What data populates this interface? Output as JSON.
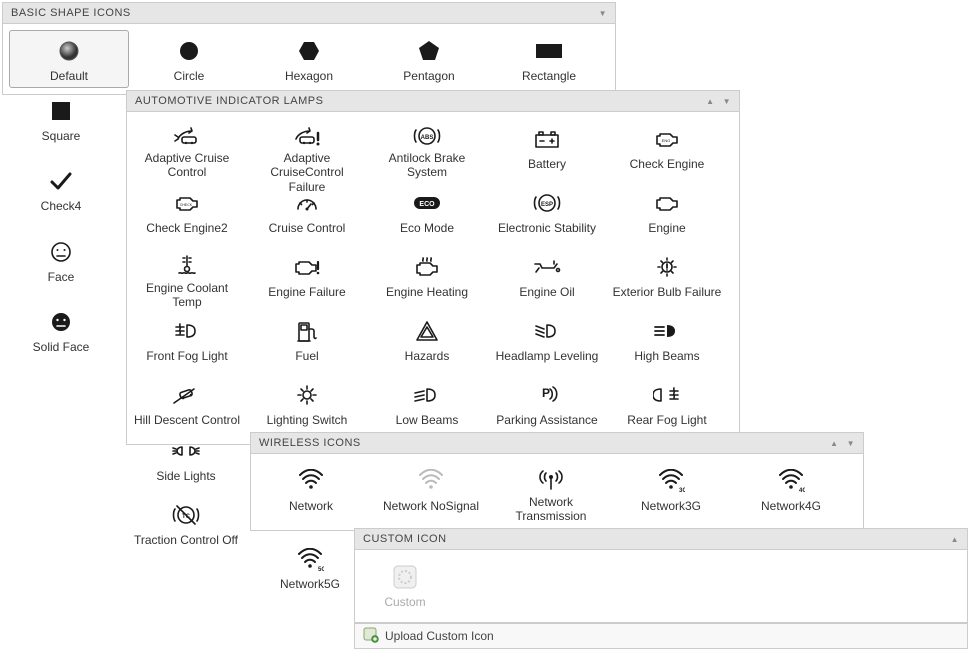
{
  "basic": {
    "title": "BASIC SHAPE ICONS",
    "items": [
      {
        "id": "default",
        "label": "Default",
        "selected": true
      },
      {
        "id": "circle",
        "label": "Circle"
      },
      {
        "id": "hexagon",
        "label": "Hexagon"
      },
      {
        "id": "pentagon",
        "label": "Pentagon"
      },
      {
        "id": "rectangle",
        "label": "Rectangle"
      }
    ],
    "side_items": [
      {
        "id": "square",
        "label": "Square"
      },
      {
        "id": "check4",
        "label": "Check4"
      },
      {
        "id": "face",
        "label": "Face"
      },
      {
        "id": "solid-face",
        "label": "Solid Face"
      }
    ]
  },
  "auto": {
    "title": "AUTOMOTIVE INDICATOR LAMPS",
    "items": [
      {
        "id": "adaptive-cruise",
        "label": "Adaptive Cruise Control"
      },
      {
        "id": "adaptive-cruise-failure",
        "label": "Adaptive CruiseControl Failure"
      },
      {
        "id": "abs",
        "label": "Antilock Brake System"
      },
      {
        "id": "battery",
        "label": "Battery"
      },
      {
        "id": "check-engine",
        "label": "Check Engine"
      },
      {
        "id": "check-engine2",
        "label": "Check Engine2"
      },
      {
        "id": "cruise-control",
        "label": "Cruise Control"
      },
      {
        "id": "eco-mode",
        "label": "Eco Mode"
      },
      {
        "id": "electronic-stability",
        "label": "Electronic Stability"
      },
      {
        "id": "engine",
        "label": "Engine"
      },
      {
        "id": "engine-coolant-temp",
        "label": "Engine Coolant Temp"
      },
      {
        "id": "engine-failure",
        "label": "Engine Failure"
      },
      {
        "id": "engine-heating",
        "label": "Engine Heating"
      },
      {
        "id": "engine-oil",
        "label": "Engine Oil"
      },
      {
        "id": "exterior-bulb-failure",
        "label": "Exterior Bulb Failure"
      },
      {
        "id": "front-fog-light",
        "label": "Front Fog Light"
      },
      {
        "id": "fuel",
        "label": "Fuel"
      },
      {
        "id": "hazards",
        "label": "Hazards"
      },
      {
        "id": "headlamp-leveling",
        "label": "Headlamp Leveling"
      },
      {
        "id": "high-beams",
        "label": "High Beams"
      },
      {
        "id": "hill-descent-control",
        "label": "Hill Descent Control"
      },
      {
        "id": "lighting-switch",
        "label": "Lighting Switch"
      },
      {
        "id": "low-beams",
        "label": "Low Beams"
      },
      {
        "id": "parking-assistance",
        "label": "Parking Assistance"
      },
      {
        "id": "rear-fog-light",
        "label": "Rear Fog Light"
      }
    ],
    "side_items": [
      {
        "id": "side-lights",
        "label": "Side Lights"
      },
      {
        "id": "traction-control-off",
        "label": "Traction Control Off"
      }
    ]
  },
  "wireless": {
    "title": "WIRELESS ICONS",
    "items": [
      {
        "id": "network",
        "label": "Network"
      },
      {
        "id": "network-nosignal",
        "label": "Network NoSignal"
      },
      {
        "id": "network-transmission",
        "label": "Network Transmission"
      },
      {
        "id": "network3g",
        "label": "Network3G"
      },
      {
        "id": "network4g",
        "label": "Network4G"
      }
    ],
    "side_items": [
      {
        "id": "network5g",
        "label": "Network5G"
      }
    ]
  },
  "custom": {
    "title": "CUSTOM ICON",
    "items": [
      {
        "id": "custom",
        "label": "Custom",
        "muted": true
      }
    ],
    "upload_label": "Upload Custom Icon"
  }
}
